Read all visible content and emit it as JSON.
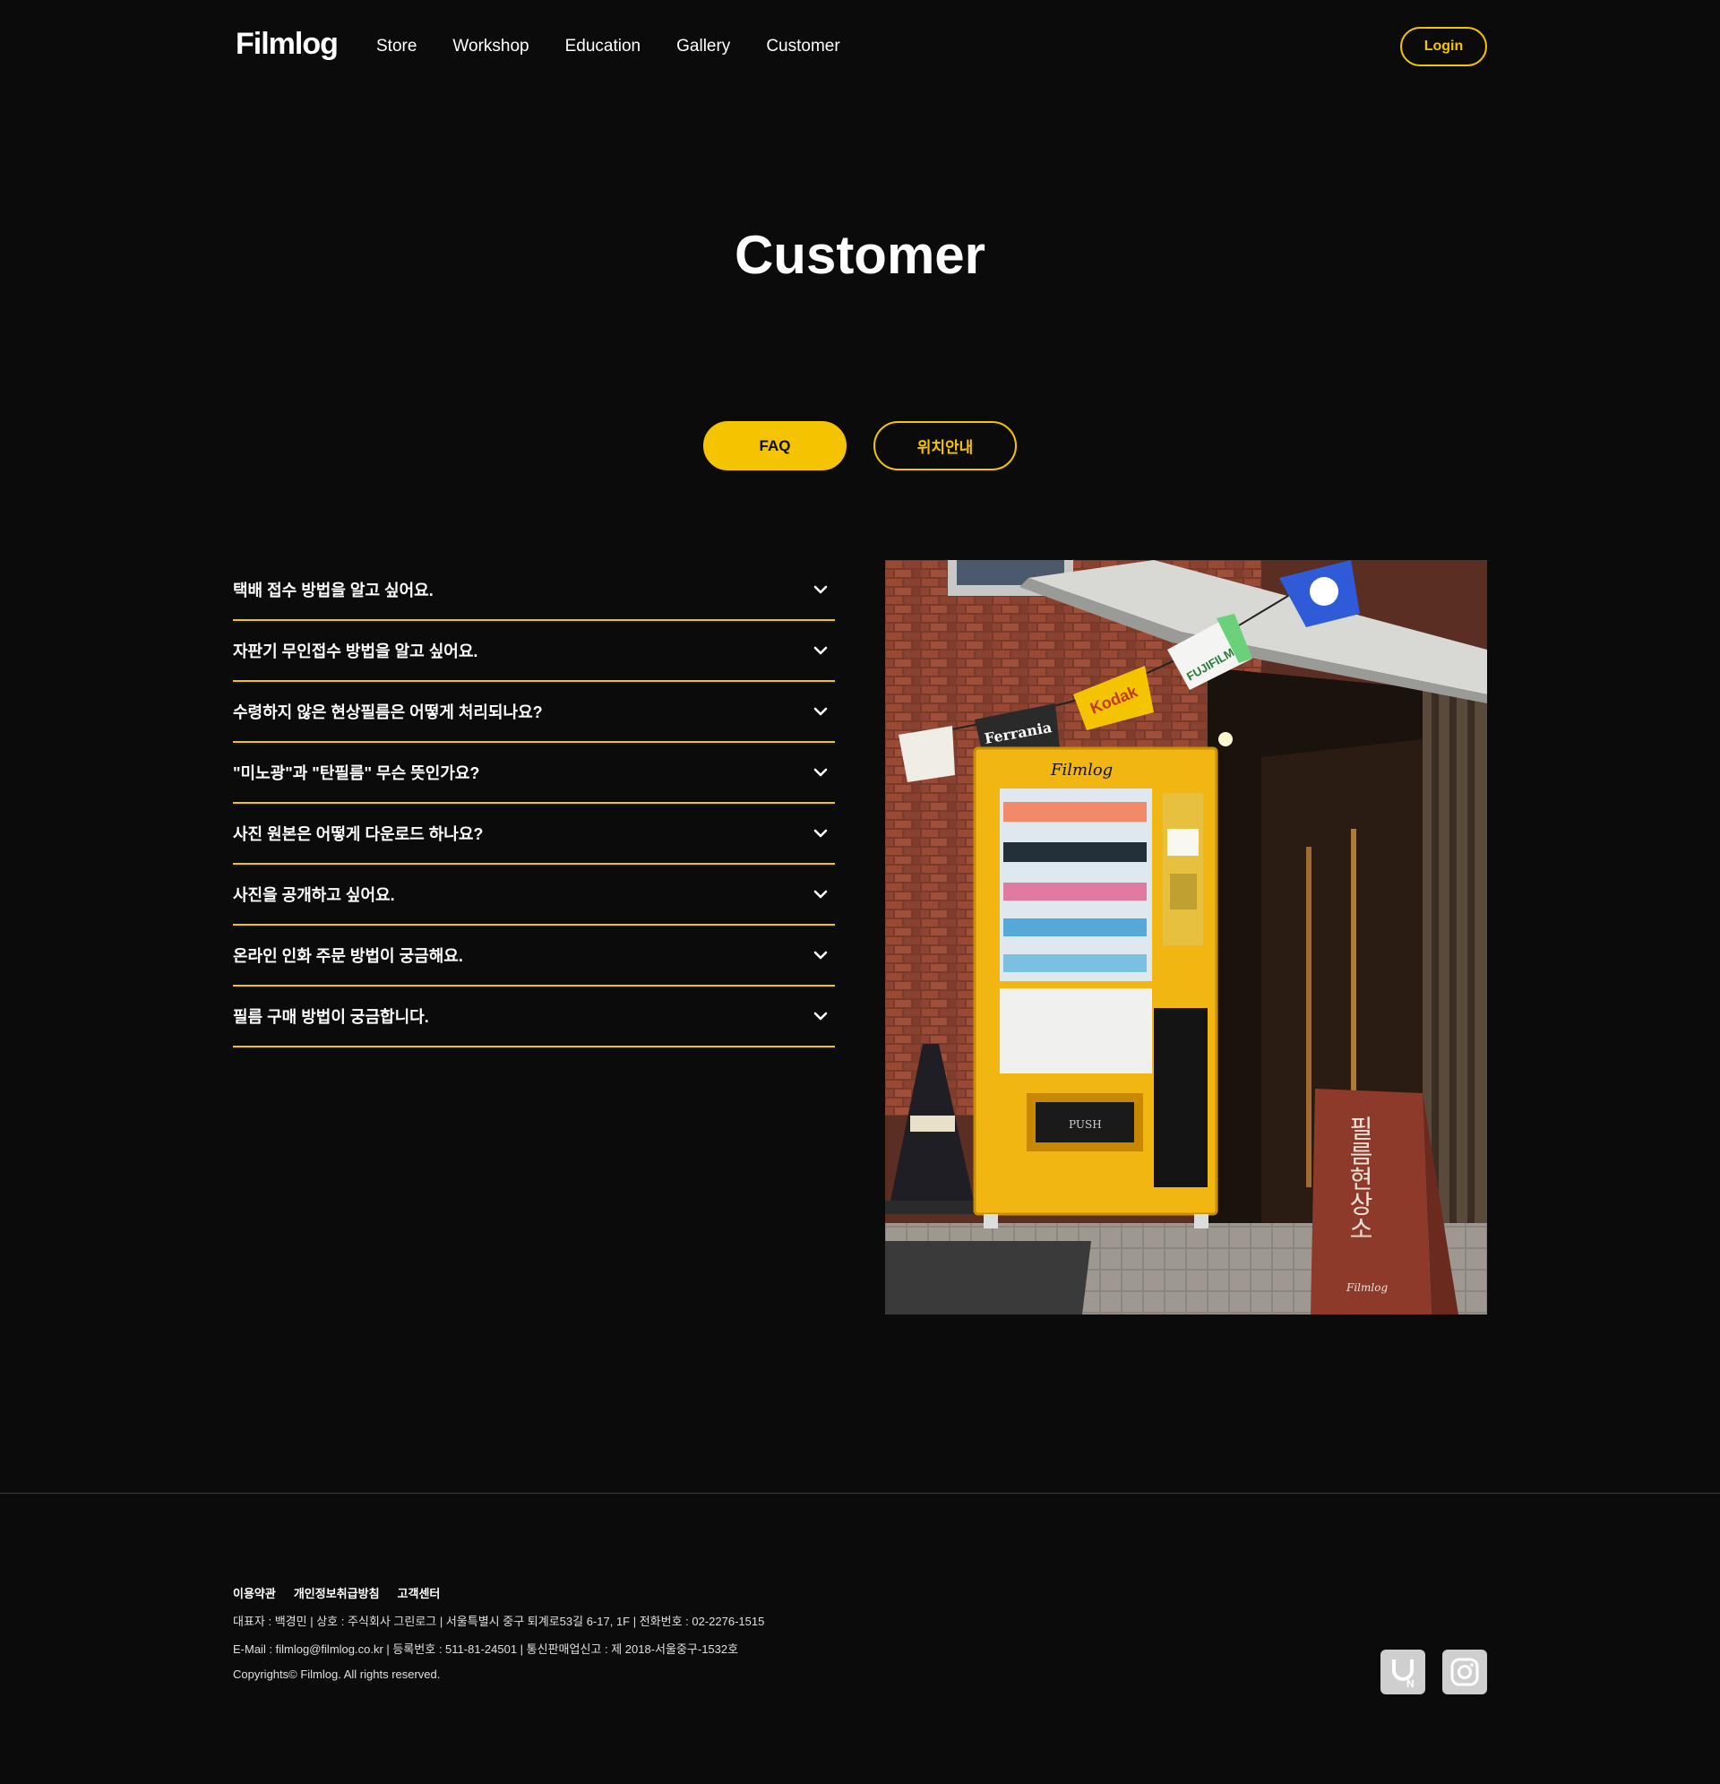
{
  "header": {
    "logo": "Filmlog",
    "nav": [
      "Store",
      "Workshop",
      "Education",
      "Gallery",
      "Customer"
    ],
    "login_label": "Login"
  },
  "page_title": "Customer",
  "tabs": [
    {
      "label": "FAQ",
      "active": true
    },
    {
      "label": "위치안내",
      "active": false
    }
  ],
  "faq": [
    "택배 접수 방법을 알고 싶어요.",
    "자판기 무인접수 방법을 알고 싶어요.",
    "수령하지 않은 현상필름은 어떻게 처리되나요?",
    "\"미노광\"과 \"탄필름\" 무슨 뜻인가요?",
    "사진 원본은 어떻게 다운로드 하나요?",
    "사진을 공개하고 싶어요.",
    "온라인 인화 주문 방법이 궁금해요.",
    "필름 구매 방법이 궁금합니다."
  ],
  "photo": {
    "flags": [
      "Ferrania",
      "Kodak",
      "FUJIFILM"
    ],
    "machine_logo": "Filmlog",
    "push_label": "PUSH",
    "sign_text": "필름현상소",
    "sign_logo": "Filmlog"
  },
  "footer": {
    "links": [
      "이용약관",
      "개인정보취급방침",
      "고객센터"
    ],
    "line1": "대표자 : 백경민 | 상호 : 주식회사 그린로그 | 서울특별시 중구 퇴계로53길 6-17, 1F | 전화번호 : 02-2276-1515",
    "line2": "E-Mail : filmlog@filmlog.co.kr | 등록번호 : 511-81-24501 | 통신판매업신고 : 제 2018-서울중구-1532호",
    "copyright": "Copyrights© Filmlog. All rights reserved."
  },
  "colors": {
    "accent": "#f5c400",
    "background": "#0b0b0b"
  },
  "icons": [
    "chevron-down-icon",
    "naver-store-icon",
    "instagram-icon"
  ]
}
